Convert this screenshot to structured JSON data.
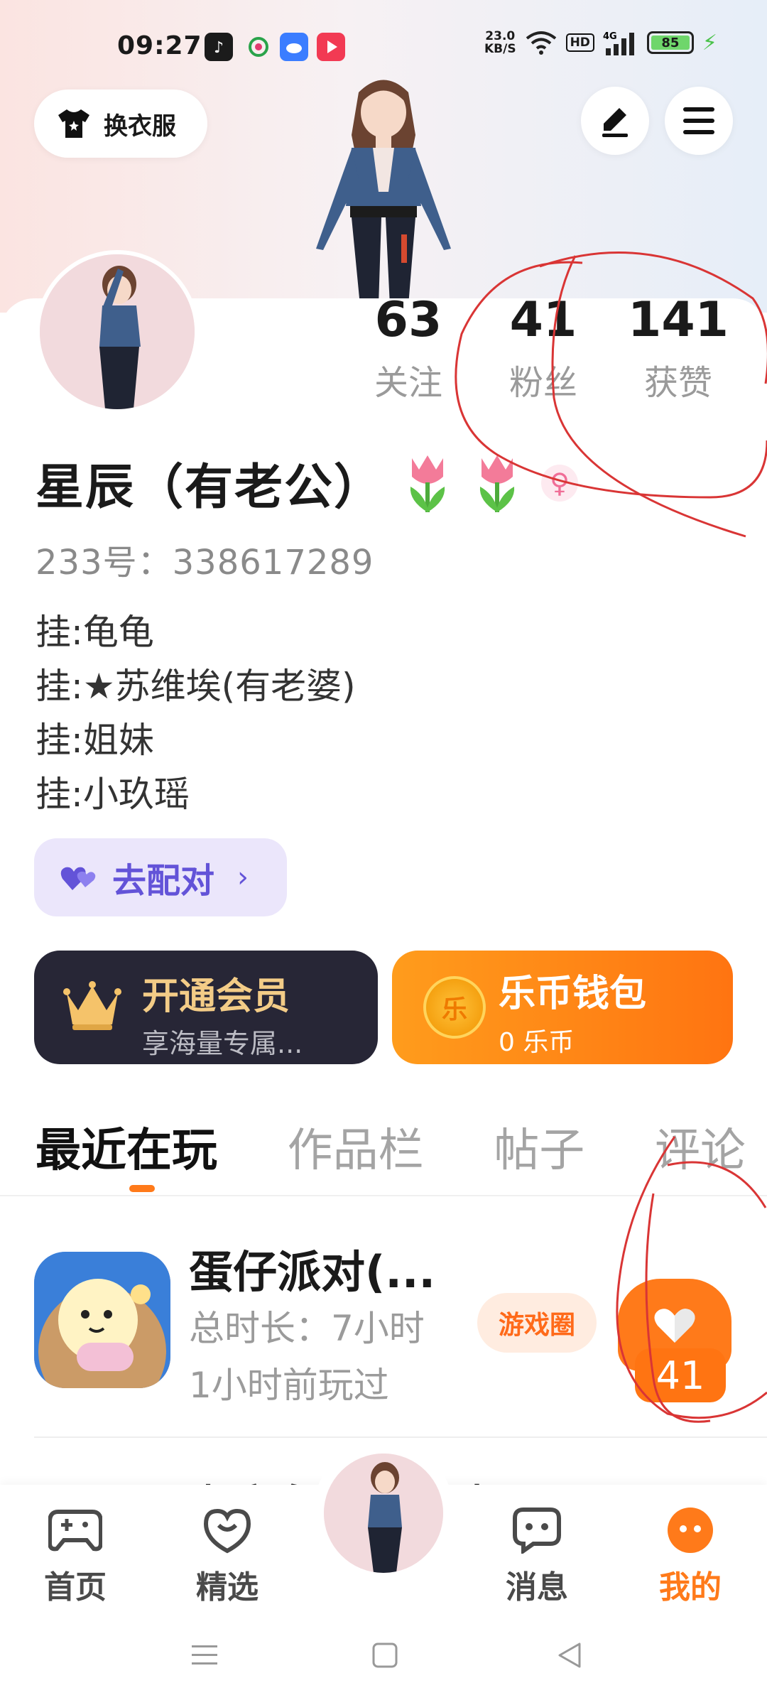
{
  "status_bar": {
    "time": "09:27",
    "net_speed_value": "23.0",
    "net_speed_unit": "KB/S",
    "hd": "HD",
    "signal": "4G",
    "battery": "85"
  },
  "header": {
    "wardrobe_label": "换衣服",
    "edit_icon": "pen-icon",
    "menu_icon": "hamburger-menu-icon"
  },
  "profile": {
    "stats": [
      {
        "num": "63",
        "label": "关注"
      },
      {
        "num": "41",
        "label": "粉丝"
      },
      {
        "num": "141",
        "label": "获赞"
      }
    ],
    "name": "星辰（有老公）",
    "gender_symbol": "♀",
    "uid": "233号：338617289",
    "bio": [
      "挂:龟龟",
      "挂:★苏维埃(有老婆)",
      "挂:姐妹",
      "挂:小玖瑶"
    ],
    "match_label": "去配对",
    "match_chevron": "›"
  },
  "cards": {
    "vip_title": "开通会员",
    "vip_sub": "享海量专属...",
    "wallet_title": "乐币钱包",
    "wallet_sub": "0 乐币",
    "coin_char": "乐"
  },
  "tabs": [
    "最近在玩",
    "作品栏",
    "帖子",
    "评论"
  ],
  "recent_game": {
    "name": "蛋仔派对(...",
    "duration": "总时长：7小时",
    "last_played": "1小时前玩过",
    "circle_label": "游戏圈",
    "like_count": "41"
  },
  "peek": {
    "text": "逝竞鱼  · · 寂酷"
  },
  "bottom_nav": [
    {
      "label": "首页",
      "icon": "gamepad-icon"
    },
    {
      "label": "精选",
      "icon": "heart-chat-icon"
    },
    {
      "label": "消息",
      "icon": "message-icon"
    },
    {
      "label": "我的",
      "icon": "profile-dots-icon"
    }
  ],
  "colors": {
    "accent": "#ff7a1a",
    "match_purple": "#6353d8",
    "vip_bg": "#272636",
    "vip_gold": "#f3cc87",
    "annotation_red": "#d93535"
  }
}
